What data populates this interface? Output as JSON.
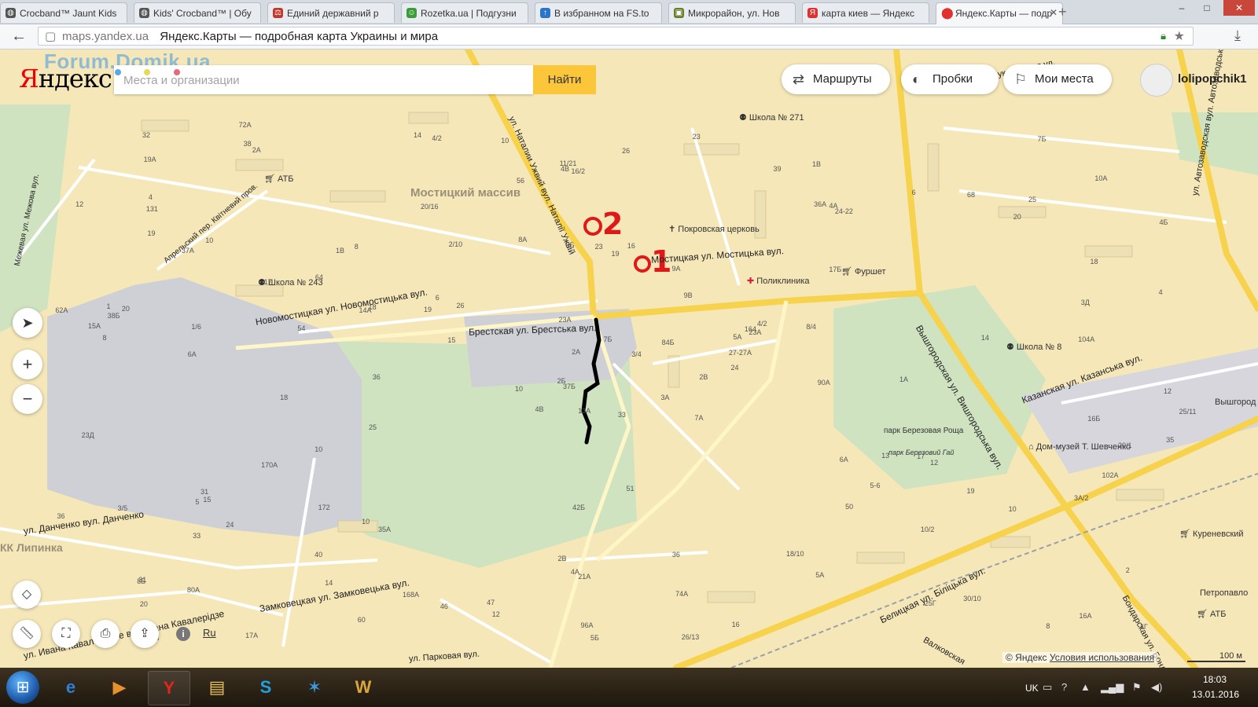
{
  "browser": {
    "tabs": [
      {
        "label": "Crocband™ Jaunt Kids",
        "icon_color": "#555555"
      },
      {
        "label": "Kids' Crocband™ | Обу",
        "icon_color": "#555555"
      },
      {
        "label": "Единий державний р",
        "icon_color": "#c0392b"
      },
      {
        "label": "Rozetka.ua | Подгузни",
        "icon_color": "#3b9c3b"
      },
      {
        "label": "В избранном на FS.to",
        "icon_color": "#2a75c9"
      },
      {
        "label": "Микрорайон, ул. Нов",
        "icon_color": "#6a7d2a"
      },
      {
        "label": "карта киев — Яндекс",
        "icon_color": "#e03030"
      },
      {
        "label": "Яндекс.Карты — подр",
        "icon_color": "#e03030"
      }
    ],
    "new_tab": "+",
    "window_controls": [
      "–",
      "□",
      "✕"
    ],
    "url_host": "maps.yandex.ua",
    "page_title": "Яндекс.Карты — подробная карта Украины и мира"
  },
  "map": {
    "watermark": "Forum.Domik.ua",
    "logo_first": "Я",
    "logo_rest": "ндекс",
    "search_placeholder": "Места и организации",
    "search_button": "Найти",
    "routes_label": "Маршруты",
    "traffic_label": "Пробки",
    "my_places_label": "Мои места",
    "username": "lolipopchik1",
    "lang": "Ru",
    "copyright_text": "© Яндекс",
    "copyright_link": "Условия использования",
    "scale": "100 м",
    "annotations": {
      "point_one": "1",
      "point_two": "2"
    },
    "districts": [
      "Мостицкий массив"
    ],
    "streets": [
      "Новомостицкая ул. Новомостицька вул.",
      "Брестская ул. Брестська вул.",
      "Мостицкая ул. Мостицька вул.",
      "Вышгородская ул. Вишгородська вул.",
      "Казанская ул. Казанська вул.",
      "Белицкая ул. Біліцька вул.",
      "Замковецкая ул. Замковецька вул.",
      "ул. Ивана Кавалеридзе вул. Івана Кавалерідзе",
      "ул. Данченко вул. Данченко",
      "Апрельский пер. Квітневий пров.",
      "Межевая ул. Межова вул.",
      "ул. Наталии Ужвий вул. Наталії Ужвій",
      "ул. Автозаводская вул. Автозаводська",
      "Мукачевская ул.",
      "Бондарская ул. Бондарська",
      "Валковская",
      "ул. Парковая вул."
    ],
    "pois": [
      "Школа № 271",
      "Школа № 243",
      "Школа № 8",
      "Покровская церковь",
      "Поликлиника",
      "Фуршет",
      "АТБ",
      "АТБ",
      "Куреневский",
      "Дом-музей Т. Шевченко",
      "парк Березовая Роща",
      "парк Березовий Гай",
      "Петропавло",
      "КК Липинка",
      "Вышгород"
    ],
    "house_numbers": [
      "33",
      "37А",
      "37Б",
      "31",
      "5А",
      "35А",
      "1В",
      "16",
      "4А",
      "2В",
      "2А",
      "4Г",
      "6А",
      "4Б",
      "4В",
      "17Б",
      "17А",
      "9Б",
      "9В",
      "24",
      "26",
      "20",
      "14",
      "23",
      "23А",
      "12",
      "10",
      "16/2",
      "8",
      "6А",
      "4",
      "2Б",
      "2В",
      "2А",
      "8",
      "6",
      "10",
      "8",
      "2",
      "17",
      "23",
      "19",
      "54",
      "50",
      "60",
      "62А",
      "27-27А",
      "23",
      "21А",
      "24",
      "33",
      "18",
      "12",
      "5-6",
      "5А",
      "40",
      "38",
      "32",
      "36",
      "25",
      "26",
      "36",
      "20",
      "64",
      "68",
      "72А",
      "39",
      "56",
      "7Б",
      "36",
      "42Б",
      "46",
      "13",
      "14А",
      "8Б",
      "19А",
      "17",
      "23Д",
      "23А",
      "74А",
      "84Б",
      "80А",
      "90А",
      "102А",
      "96А",
      "104А",
      "51",
      "30/10",
      "26/13",
      "18/10",
      "11/21",
      "25/11",
      "8/4",
      "10/2",
      "3/4",
      "3А/2",
      "38Б",
      "5Б",
      "36А",
      "24-22",
      "18",
      "14",
      "12",
      "15А",
      "170А",
      "172",
      "168А",
      "164",
      "20",
      "15",
      "16Б",
      "131",
      "19",
      "10",
      "4/2",
      "3/5",
      "13А",
      "10А",
      "8А",
      "10",
      "5",
      "7Б",
      "9А",
      "2/10",
      "1А",
      "10",
      "16А",
      "12",
      "14",
      "19",
      "15",
      "16",
      "18",
      "20/16",
      "20/1",
      "19",
      "25",
      "31",
      "35",
      "6",
      "7А",
      "1/6",
      "10",
      "3А",
      "4/2",
      "4",
      "47",
      "25Г",
      "4А",
      "4В",
      "3Д",
      "1В",
      "1"
    ]
  },
  "taskbar": {
    "lang": "UK",
    "time": "18:03",
    "date": "13.01.2016",
    "apps": [
      {
        "name": "internet-explorer",
        "glyph": "e",
        "color": "#2f7fd6"
      },
      {
        "name": "media-player",
        "glyph": "▶",
        "color": "#e7912d"
      },
      {
        "name": "yandex-browser",
        "glyph": "Y",
        "color": "#e2261c"
      },
      {
        "name": "file-explorer",
        "glyph": "▤",
        "color": "#e9c15a"
      },
      {
        "name": "skype",
        "glyph": "S",
        "color": "#1fa1e1"
      },
      {
        "name": "battle-net",
        "glyph": "✶",
        "color": "#3a9ae0"
      },
      {
        "name": "world-of-warcraft",
        "glyph": "W",
        "color": "#d8a63a"
      }
    ]
  }
}
